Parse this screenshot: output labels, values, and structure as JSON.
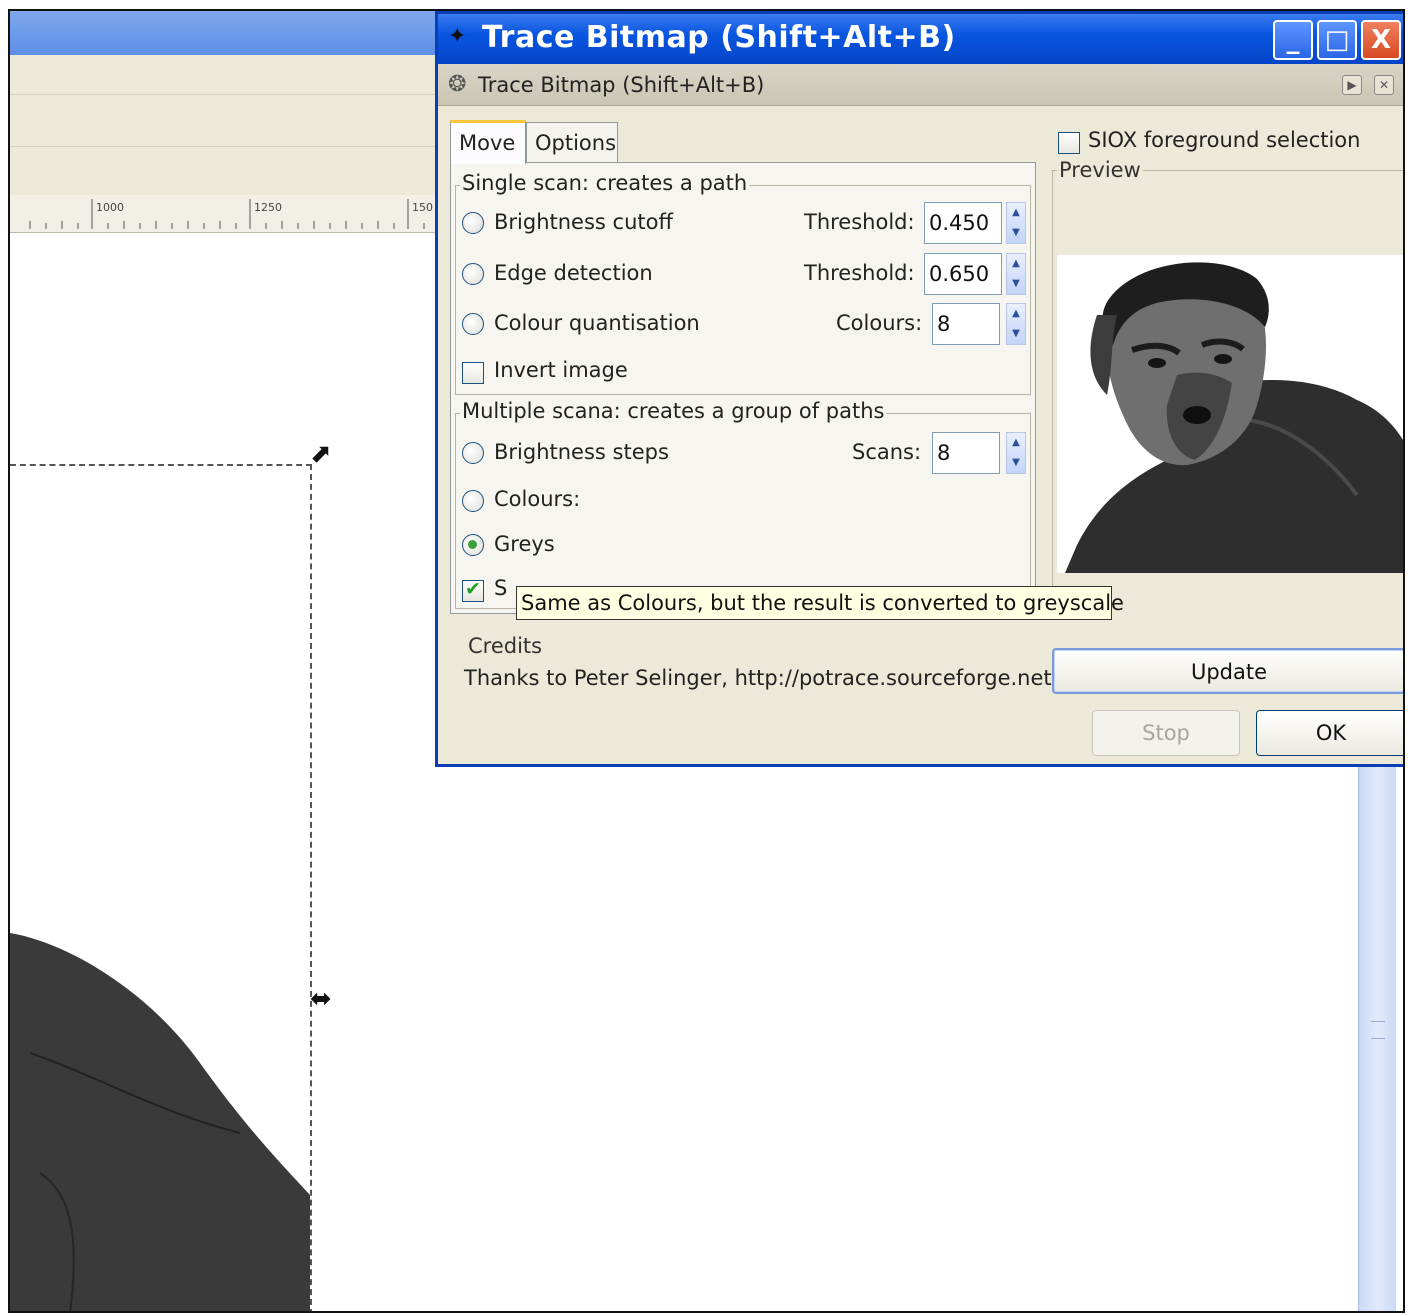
{
  "background": {
    "ruler_labels": [
      "1000",
      "1250",
      "150"
    ]
  },
  "dialog": {
    "title": "Trace Bitmap (Shift+Alt+B)",
    "dock_title": "Trace Bitmap (Shift+Alt+B)",
    "window_buttons": {
      "minimize": "_",
      "maximize": "□",
      "close": "X"
    },
    "dock_buttons": {
      "iconify": "▶",
      "close": "✕"
    },
    "tabs": [
      {
        "label": "Move",
        "active": true
      },
      {
        "label": "Options",
        "active": false
      }
    ],
    "single_scan": {
      "title": "Single scan: creates a path",
      "brightness_cutoff": {
        "label": "Brightness cutoff",
        "field_label": "Threshold:",
        "value": "0.450",
        "selected": false
      },
      "edge_detection": {
        "label": "Edge detection",
        "field_label": "Threshold:",
        "value": "0.650",
        "selected": false
      },
      "colour_quantisation": {
        "label": "Colour quantisation",
        "field_label": "Colours:",
        "value": "8",
        "selected": false
      },
      "invert_image": {
        "label": "Invert image",
        "checked": false
      }
    },
    "multiple_scans": {
      "title": "Multiple scana: creates a group of paths",
      "brightness_steps": {
        "label": "Brightness steps",
        "field_label": "Scans:",
        "value": "8",
        "selected": false
      },
      "colours": {
        "label": "Colours:",
        "selected": false
      },
      "greys": {
        "label": "Greys",
        "selected": true
      },
      "smooth": {
        "label": "S",
        "checked": true
      }
    },
    "tooltip": "Same as Colours, but the result is converted to greyscale",
    "credits": {
      "title": "Credits",
      "text": "Thanks to Peter Selinger, http://potrace.sourceforge.net"
    },
    "siox": {
      "label": "SIOX foreground selection",
      "checked": false
    },
    "preview": {
      "title": "Preview"
    },
    "buttons": {
      "update": "Update",
      "stop": "Stop",
      "ok": "OK"
    },
    "colors": {
      "title_bar": "#0a56e0",
      "dialog_bg": "#ece9d8",
      "tooltip_bg": "#ffffe1",
      "radio_selected": "#3aa13a"
    }
  }
}
